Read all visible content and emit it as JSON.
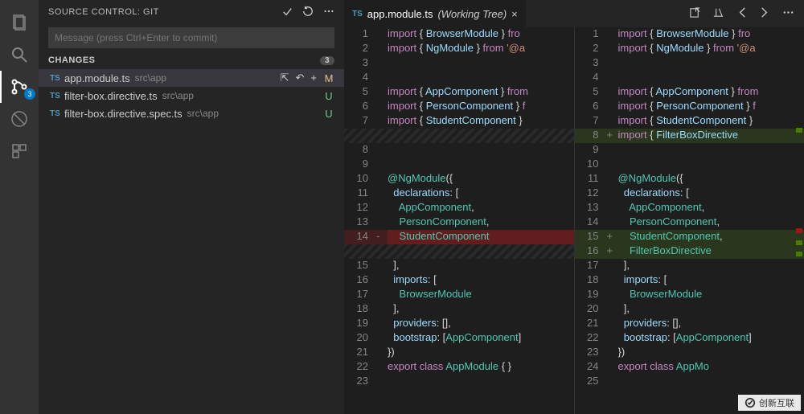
{
  "activitybar": {
    "scm_badge": "3"
  },
  "sidebar": {
    "title": "SOURCE CONTROL: GIT",
    "commit_placeholder": "Message (press Ctrl+Enter to commit)",
    "changes_label": "CHANGES",
    "changes_count": "3",
    "files": [
      {
        "lang": "TS",
        "name": "app.module.ts",
        "path": "src\\app",
        "status": "M",
        "selected": true
      },
      {
        "lang": "TS",
        "name": "filter-box.directive.ts",
        "path": "src\\app",
        "status": "U"
      },
      {
        "lang": "TS",
        "name": "filter-box.directive.spec.ts",
        "path": "src\\app",
        "status": "U"
      }
    ]
  },
  "tab": {
    "lang": "TS",
    "name": "app.module.ts",
    "suffix": "(Working Tree)",
    "close": "×"
  },
  "left_pane": {
    "lines": [
      {
        "n": "1",
        "t": "code",
        "tokens": [
          [
            "kw",
            "import"
          ],
          [
            "br",
            " { "
          ],
          [
            "id",
            "BrowserModule"
          ],
          [
            "br",
            " } "
          ],
          [
            "kw",
            "fro"
          ]
        ]
      },
      {
        "n": "2",
        "t": "code",
        "tokens": [
          [
            "kw",
            "import"
          ],
          [
            "br",
            " { "
          ],
          [
            "id",
            "NgModule"
          ],
          [
            "br",
            " } "
          ],
          [
            "kw",
            "from"
          ],
          [
            "br",
            " "
          ],
          [
            "st",
            "'@a"
          ]
        ]
      },
      {
        "n": "3",
        "t": "code",
        "tokens": []
      },
      {
        "n": "4",
        "t": "code",
        "tokens": []
      },
      {
        "n": "5",
        "t": "code",
        "tokens": [
          [
            "kw",
            "import"
          ],
          [
            "br",
            " { "
          ],
          [
            "id",
            "AppComponent"
          ],
          [
            "br",
            " } "
          ],
          [
            "kw",
            "from"
          ]
        ]
      },
      {
        "n": "6",
        "t": "code",
        "tokens": [
          [
            "kw",
            "import"
          ],
          [
            "br",
            " { "
          ],
          [
            "id",
            "PersonComponent"
          ],
          [
            "br",
            " } "
          ],
          [
            "kw",
            "f"
          ]
        ]
      },
      {
        "n": "7",
        "t": "code",
        "tokens": [
          [
            "kw",
            "import"
          ],
          [
            "br",
            " { "
          ],
          [
            "id",
            "StudentComponent"
          ],
          [
            "br",
            " }"
          ]
        ]
      },
      {
        "n": "",
        "t": "hatch",
        "tokens": []
      },
      {
        "n": "8",
        "t": "code",
        "tokens": []
      },
      {
        "n": "9",
        "t": "code",
        "tokens": []
      },
      {
        "n": "10",
        "t": "code",
        "tokens": [
          [
            "dec",
            "@NgModule"
          ],
          [
            "br",
            "({"
          ]
        ]
      },
      {
        "n": "11",
        "t": "code",
        "tokens": [
          [
            "br",
            "  "
          ],
          [
            "id",
            "declarations"
          ],
          [
            "br",
            ": ["
          ]
        ]
      },
      {
        "n": "12",
        "t": "code",
        "tokens": [
          [
            "br",
            "    "
          ],
          [
            "ty",
            "AppComponent"
          ],
          [
            "br",
            ","
          ]
        ]
      },
      {
        "n": "13",
        "t": "code",
        "tokens": [
          [
            "br",
            "    "
          ],
          [
            "ty",
            "PersonComponent"
          ],
          [
            "br",
            ","
          ]
        ]
      },
      {
        "n": "14",
        "t": "del",
        "sign": "-",
        "tokens": [
          [
            "br",
            "    "
          ],
          [
            "ty",
            "StudentComponent"
          ]
        ]
      },
      {
        "n": "",
        "t": "hatch",
        "tokens": []
      },
      {
        "n": "15",
        "t": "code",
        "tokens": [
          [
            "br",
            "  ],"
          ]
        ]
      },
      {
        "n": "16",
        "t": "code",
        "tokens": [
          [
            "br",
            "  "
          ],
          [
            "id",
            "imports"
          ],
          [
            "br",
            ": ["
          ]
        ]
      },
      {
        "n": "17",
        "t": "code",
        "tokens": [
          [
            "br",
            "    "
          ],
          [
            "ty",
            "BrowserModule"
          ]
        ]
      },
      {
        "n": "18",
        "t": "code",
        "tokens": [
          [
            "br",
            "  ],"
          ]
        ]
      },
      {
        "n": "19",
        "t": "code",
        "tokens": [
          [
            "br",
            "  "
          ],
          [
            "id",
            "providers"
          ],
          [
            "br",
            ": [],"
          ]
        ]
      },
      {
        "n": "20",
        "t": "code",
        "tokens": [
          [
            "br",
            "  "
          ],
          [
            "id",
            "bootstrap"
          ],
          [
            "br",
            ": ["
          ],
          [
            "ty",
            "AppComponent"
          ],
          [
            "br",
            "]"
          ]
        ]
      },
      {
        "n": "21",
        "t": "code",
        "tokens": [
          [
            "br",
            "})"
          ]
        ]
      },
      {
        "n": "22",
        "t": "code",
        "tokens": [
          [
            "kw",
            "export"
          ],
          [
            "br",
            " "
          ],
          [
            "kw",
            "class"
          ],
          [
            "br",
            " "
          ],
          [
            "ty",
            "AppModule"
          ],
          [
            "br",
            " { }"
          ]
        ]
      },
      {
        "n": "23",
        "t": "code",
        "tokens": []
      }
    ]
  },
  "right_pane": {
    "lines": [
      {
        "n": "1",
        "t": "code",
        "tokens": [
          [
            "kw",
            "import"
          ],
          [
            "br",
            " { "
          ],
          [
            "id",
            "BrowserModule"
          ],
          [
            "br",
            " } "
          ],
          [
            "kw",
            "fro"
          ]
        ]
      },
      {
        "n": "2",
        "t": "code",
        "tokens": [
          [
            "kw",
            "import"
          ],
          [
            "br",
            " { "
          ],
          [
            "id",
            "NgModule"
          ],
          [
            "br",
            " } "
          ],
          [
            "kw",
            "from"
          ],
          [
            "br",
            " "
          ],
          [
            "st",
            "'@a"
          ]
        ]
      },
      {
        "n": "3",
        "t": "code",
        "tokens": []
      },
      {
        "n": "4",
        "t": "code",
        "tokens": []
      },
      {
        "n": "5",
        "t": "code",
        "tokens": [
          [
            "kw",
            "import"
          ],
          [
            "br",
            " { "
          ],
          [
            "id",
            "AppComponent"
          ],
          [
            "br",
            " } "
          ],
          [
            "kw",
            "from"
          ]
        ]
      },
      {
        "n": "6",
        "t": "code",
        "tokens": [
          [
            "kw",
            "import"
          ],
          [
            "br",
            " { "
          ],
          [
            "id",
            "PersonComponent"
          ],
          [
            "br",
            " } "
          ],
          [
            "kw",
            "f"
          ]
        ]
      },
      {
        "n": "7",
        "t": "code",
        "tokens": [
          [
            "kw",
            "import"
          ],
          [
            "br",
            " { "
          ],
          [
            "id",
            "StudentComponent"
          ],
          [
            "br",
            " }"
          ]
        ]
      },
      {
        "n": "8",
        "t": "add",
        "sign": "+",
        "tokens": [
          [
            "kw",
            "import"
          ],
          [
            "br",
            " { "
          ],
          [
            "id",
            "FilterBoxDirective"
          ]
        ]
      },
      {
        "n": "9",
        "t": "code",
        "tokens": []
      },
      {
        "n": "10",
        "t": "code",
        "tokens": []
      },
      {
        "n": "11",
        "t": "code",
        "tokens": [
          [
            "dec",
            "@NgModule"
          ],
          [
            "br",
            "({"
          ]
        ]
      },
      {
        "n": "12",
        "t": "code",
        "tokens": [
          [
            "br",
            "  "
          ],
          [
            "id",
            "declarations"
          ],
          [
            "br",
            ": ["
          ]
        ]
      },
      {
        "n": "13",
        "t": "code",
        "tokens": [
          [
            "br",
            "    "
          ],
          [
            "ty",
            "AppComponent"
          ],
          [
            "br",
            ","
          ]
        ]
      },
      {
        "n": "14",
        "t": "code",
        "tokens": [
          [
            "br",
            "    "
          ],
          [
            "ty",
            "PersonComponent"
          ],
          [
            "br",
            ","
          ]
        ]
      },
      {
        "n": "15",
        "t": "add",
        "sign": "+",
        "tokens": [
          [
            "br",
            "    "
          ],
          [
            "ty",
            "StudentComponent"
          ],
          [
            "br",
            ","
          ]
        ]
      },
      {
        "n": "16",
        "t": "add",
        "sign": "+",
        "tokens": [
          [
            "br",
            "    "
          ],
          [
            "ty",
            "FilterBoxDirective"
          ]
        ]
      },
      {
        "n": "17",
        "t": "code",
        "tokens": [
          [
            "br",
            "  ],"
          ]
        ]
      },
      {
        "n": "18",
        "t": "code",
        "tokens": [
          [
            "br",
            "  "
          ],
          [
            "id",
            "imports"
          ],
          [
            "br",
            ": ["
          ]
        ]
      },
      {
        "n": "19",
        "t": "code",
        "tokens": [
          [
            "br",
            "    "
          ],
          [
            "ty",
            "BrowserModule"
          ]
        ]
      },
      {
        "n": "20",
        "t": "code",
        "tokens": [
          [
            "br",
            "  ],"
          ]
        ]
      },
      {
        "n": "21",
        "t": "code",
        "tokens": [
          [
            "br",
            "  "
          ],
          [
            "id",
            "providers"
          ],
          [
            "br",
            ": [],"
          ]
        ]
      },
      {
        "n": "22",
        "t": "code",
        "tokens": [
          [
            "br",
            "  "
          ],
          [
            "id",
            "bootstrap"
          ],
          [
            "br",
            ": ["
          ],
          [
            "ty",
            "AppComponent"
          ],
          [
            "br",
            "]"
          ]
        ]
      },
      {
        "n": "23",
        "t": "code",
        "tokens": [
          [
            "br",
            "})"
          ]
        ]
      },
      {
        "n": "24",
        "t": "code",
        "tokens": [
          [
            "kw",
            "export"
          ],
          [
            "br",
            " "
          ],
          [
            "kw",
            "class"
          ],
          [
            "br",
            " "
          ],
          [
            "ty",
            "AppMo"
          ]
        ]
      },
      {
        "n": "25",
        "t": "code",
        "tokens": []
      }
    ]
  },
  "watermark": "创新互联"
}
